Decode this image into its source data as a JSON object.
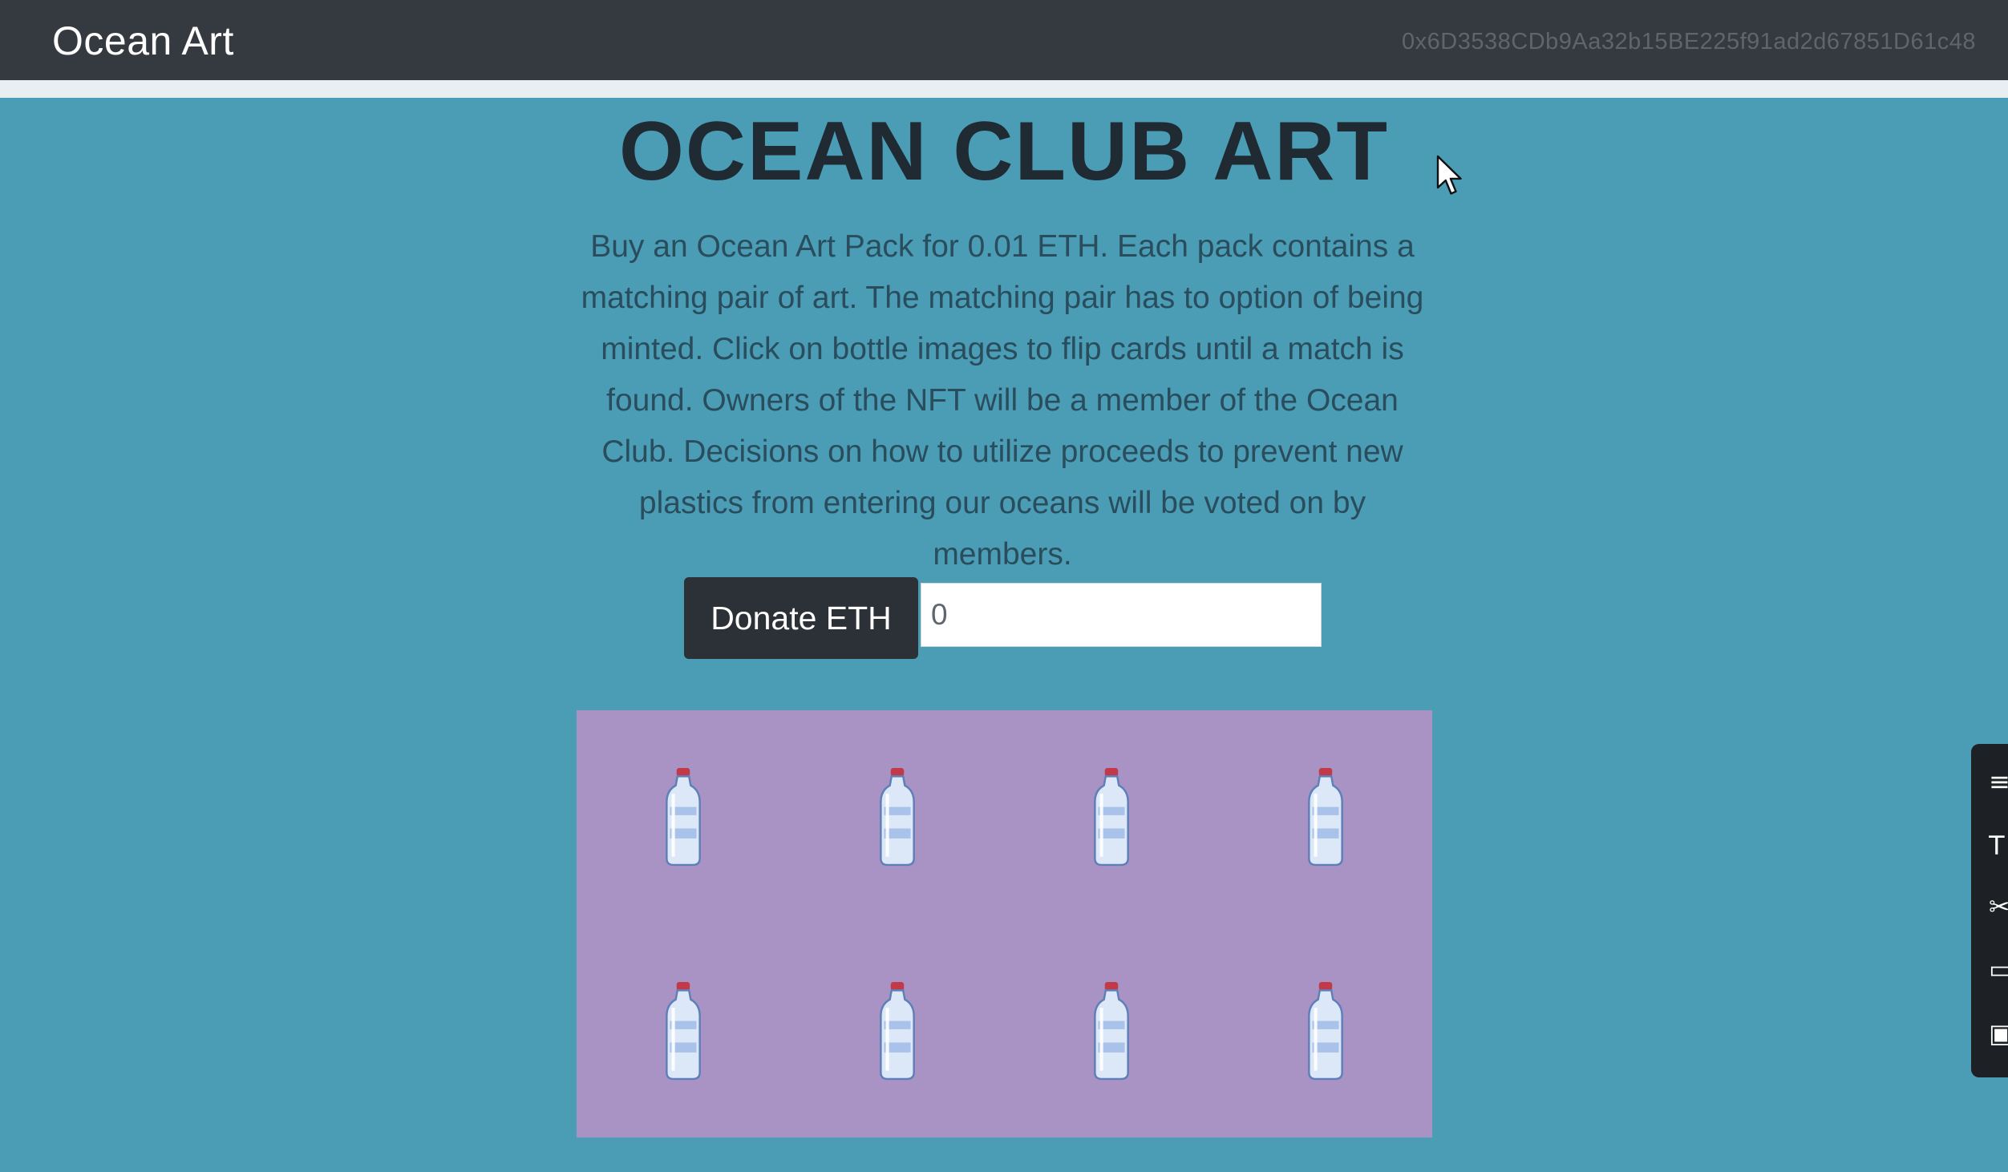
{
  "navbar": {
    "brand": "Ocean Art",
    "account_address": "0x6D3538CDb9Aa32b15BE225f91ad2d67851D61c48"
  },
  "main": {
    "title": "OCEAN CLUB ART",
    "description": "Buy an Ocean Art Pack for 0.01 ETH. Each pack contains a matching pair of art. The matching pair has to option of being minted. Click on bottle images to flip cards until a match is found. Owners of the NFT will be a member of the Ocean Club. Decisions on how to utilize proceeds to prevent new plastics from entering our oceans will be voted on by members.",
    "donate_button_label": "Donate ETH",
    "donate_input_value": "0"
  },
  "cards": {
    "rows": 2,
    "columns": 4,
    "face_down_icon": "water-bottle-icon",
    "background_color": "#a993c4"
  },
  "side_panel": {
    "icons": [
      "menu-icon",
      "text-tool-icon",
      "cut-icon",
      "comment-icon",
      "image-icon"
    ]
  },
  "colors": {
    "page_background": "#4b9db5",
    "navbar_background": "#353a40",
    "button_background": "#2c3137"
  }
}
